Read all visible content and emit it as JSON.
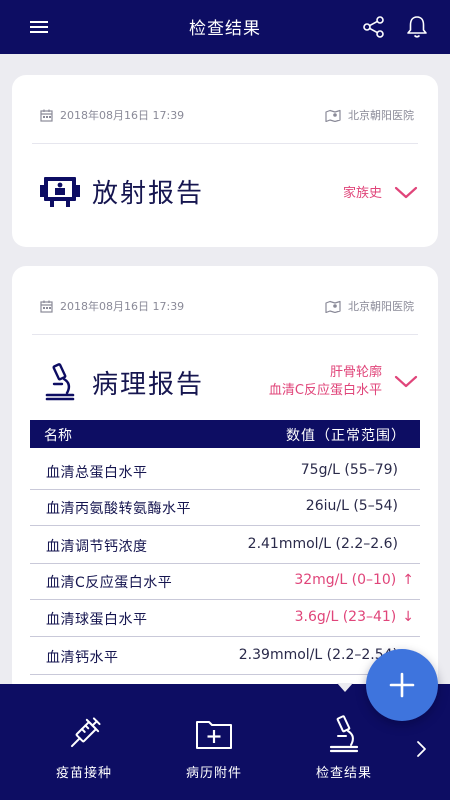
{
  "header": {
    "title": "检查结果"
  },
  "reports": [
    {
      "date": "2018年08月16日 17:39",
      "hospital": "北京朝阳医院",
      "title": "放射报告",
      "tags": [
        "家族史"
      ]
    },
    {
      "date": "2018年08月16日 17:39",
      "hospital": "北京朝阳医院",
      "title": "病理报告",
      "tags": [
        "肝骨轮廓",
        "血清C反应蛋白水平"
      ],
      "table": {
        "headers": [
          "名称",
          "数值（正常范围）"
        ],
        "rows": [
          {
            "name": "血清总蛋白水平",
            "value": "75g/L (55–79)",
            "flag": ""
          },
          {
            "name": "血清丙氨酸转氨酶水平",
            "value": "26iu/L (5–54)",
            "flag": ""
          },
          {
            "name": "血清调节钙浓度",
            "value": "2.41mmol/L (2.2–2.6)",
            "flag": ""
          },
          {
            "name": "血清C反应蛋白水平",
            "value": "32mg/L (0–10)",
            "flag": "↑"
          },
          {
            "name": "血清球蛋白水平",
            "value": "3.6g/L (23–41)",
            "flag": "↓"
          },
          {
            "name": "血清钙水平",
            "value": "2.39mmol/L (2.2–2.54)",
            "flag": ""
          }
        ]
      }
    }
  ],
  "bottom_nav": [
    {
      "label": "疫苗接种",
      "icon": "syringe-icon"
    },
    {
      "label": "病历附件",
      "icon": "folder-plus-icon"
    },
    {
      "label": "检查结果",
      "icon": "microscope-icon"
    }
  ],
  "colors": {
    "primary": "#0d0d63",
    "accent": "#e0457a",
    "fab": "#3e74dd",
    "background": "#ececf1"
  }
}
